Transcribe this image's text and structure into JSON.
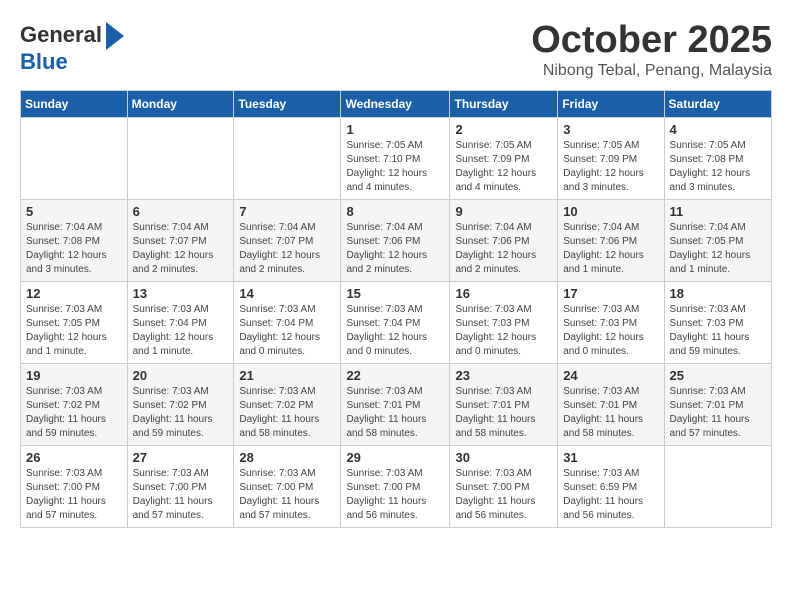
{
  "logo": {
    "line1": "General",
    "line2": "Blue"
  },
  "title": "October 2025",
  "subtitle": "Nibong Tebal, Penang, Malaysia",
  "headers": [
    "Sunday",
    "Monday",
    "Tuesday",
    "Wednesday",
    "Thursday",
    "Friday",
    "Saturday"
  ],
  "weeks": [
    [
      {
        "day": "",
        "info": ""
      },
      {
        "day": "",
        "info": ""
      },
      {
        "day": "",
        "info": ""
      },
      {
        "day": "1",
        "info": "Sunrise: 7:05 AM\nSunset: 7:10 PM\nDaylight: 12 hours\nand 4 minutes."
      },
      {
        "day": "2",
        "info": "Sunrise: 7:05 AM\nSunset: 7:09 PM\nDaylight: 12 hours\nand 4 minutes."
      },
      {
        "day": "3",
        "info": "Sunrise: 7:05 AM\nSunset: 7:09 PM\nDaylight: 12 hours\nand 3 minutes."
      },
      {
        "day": "4",
        "info": "Sunrise: 7:05 AM\nSunset: 7:08 PM\nDaylight: 12 hours\nand 3 minutes."
      }
    ],
    [
      {
        "day": "5",
        "info": "Sunrise: 7:04 AM\nSunset: 7:08 PM\nDaylight: 12 hours\nand 3 minutes."
      },
      {
        "day": "6",
        "info": "Sunrise: 7:04 AM\nSunset: 7:07 PM\nDaylight: 12 hours\nand 2 minutes."
      },
      {
        "day": "7",
        "info": "Sunrise: 7:04 AM\nSunset: 7:07 PM\nDaylight: 12 hours\nand 2 minutes."
      },
      {
        "day": "8",
        "info": "Sunrise: 7:04 AM\nSunset: 7:06 PM\nDaylight: 12 hours\nand 2 minutes."
      },
      {
        "day": "9",
        "info": "Sunrise: 7:04 AM\nSunset: 7:06 PM\nDaylight: 12 hours\nand 2 minutes."
      },
      {
        "day": "10",
        "info": "Sunrise: 7:04 AM\nSunset: 7:06 PM\nDaylight: 12 hours\nand 1 minute."
      },
      {
        "day": "11",
        "info": "Sunrise: 7:04 AM\nSunset: 7:05 PM\nDaylight: 12 hours\nand 1 minute."
      }
    ],
    [
      {
        "day": "12",
        "info": "Sunrise: 7:03 AM\nSunset: 7:05 PM\nDaylight: 12 hours\nand 1 minute."
      },
      {
        "day": "13",
        "info": "Sunrise: 7:03 AM\nSunset: 7:04 PM\nDaylight: 12 hours\nand 1 minute."
      },
      {
        "day": "14",
        "info": "Sunrise: 7:03 AM\nSunset: 7:04 PM\nDaylight: 12 hours\nand 0 minutes."
      },
      {
        "day": "15",
        "info": "Sunrise: 7:03 AM\nSunset: 7:04 PM\nDaylight: 12 hours\nand 0 minutes."
      },
      {
        "day": "16",
        "info": "Sunrise: 7:03 AM\nSunset: 7:03 PM\nDaylight: 12 hours\nand 0 minutes."
      },
      {
        "day": "17",
        "info": "Sunrise: 7:03 AM\nSunset: 7:03 PM\nDaylight: 12 hours\nand 0 minutes."
      },
      {
        "day": "18",
        "info": "Sunrise: 7:03 AM\nSunset: 7:03 PM\nDaylight: 11 hours\nand 59 minutes."
      }
    ],
    [
      {
        "day": "19",
        "info": "Sunrise: 7:03 AM\nSunset: 7:02 PM\nDaylight: 11 hours\nand 59 minutes."
      },
      {
        "day": "20",
        "info": "Sunrise: 7:03 AM\nSunset: 7:02 PM\nDaylight: 11 hours\nand 59 minutes."
      },
      {
        "day": "21",
        "info": "Sunrise: 7:03 AM\nSunset: 7:02 PM\nDaylight: 11 hours\nand 58 minutes."
      },
      {
        "day": "22",
        "info": "Sunrise: 7:03 AM\nSunset: 7:01 PM\nDaylight: 11 hours\nand 58 minutes."
      },
      {
        "day": "23",
        "info": "Sunrise: 7:03 AM\nSunset: 7:01 PM\nDaylight: 11 hours\nand 58 minutes."
      },
      {
        "day": "24",
        "info": "Sunrise: 7:03 AM\nSunset: 7:01 PM\nDaylight: 11 hours\nand 58 minutes."
      },
      {
        "day": "25",
        "info": "Sunrise: 7:03 AM\nSunset: 7:01 PM\nDaylight: 11 hours\nand 57 minutes."
      }
    ],
    [
      {
        "day": "26",
        "info": "Sunrise: 7:03 AM\nSunset: 7:00 PM\nDaylight: 11 hours\nand 57 minutes."
      },
      {
        "day": "27",
        "info": "Sunrise: 7:03 AM\nSunset: 7:00 PM\nDaylight: 11 hours\nand 57 minutes."
      },
      {
        "day": "28",
        "info": "Sunrise: 7:03 AM\nSunset: 7:00 PM\nDaylight: 11 hours\nand 57 minutes."
      },
      {
        "day": "29",
        "info": "Sunrise: 7:03 AM\nSunset: 7:00 PM\nDaylight: 11 hours\nand 56 minutes."
      },
      {
        "day": "30",
        "info": "Sunrise: 7:03 AM\nSunset: 7:00 PM\nDaylight: 11 hours\nand 56 minutes."
      },
      {
        "day": "31",
        "info": "Sunrise: 7:03 AM\nSunset: 6:59 PM\nDaylight: 11 hours\nand 56 minutes."
      },
      {
        "day": "",
        "info": ""
      }
    ]
  ]
}
